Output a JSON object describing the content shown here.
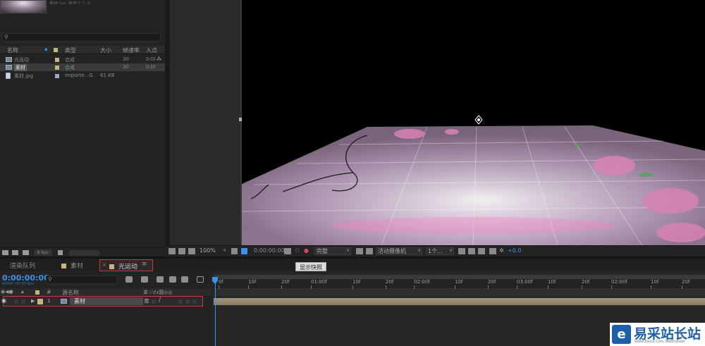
{
  "colors": {
    "timecode": "#3b93e8",
    "label_sandstone": "#c8b47e",
    "highlight_box": "#c53a3a",
    "watermark_blue": "#1d5fa8"
  },
  "project": {
    "thumb_info": "素材.jpg, 使用了 1 次",
    "search_placeholder": "",
    "columns": {
      "name": "名称",
      "type": "类型",
      "size": "大小",
      "fps": "帧速率",
      "in": "入点"
    },
    "items": [
      {
        "name": "光运动",
        "type": "合成",
        "size": "",
        "fps": "30",
        "in": "0:0(",
        "icon": "composition-icon"
      },
      {
        "name": "素材",
        "type": "合成",
        "size": "",
        "fps": "30",
        "in": "0:0(",
        "icon": "composition-icon"
      },
      {
        "name": "素材.jpg",
        "type": "Importe...G",
        "size": "61 KB",
        "fps": "",
        "in": "",
        "icon": "image-file-icon"
      }
    ],
    "bpc": "8 bpc"
  },
  "viewer_toolbar": {
    "zoom": "100%",
    "timecode": "0:00:00:00",
    "resolution": "完整",
    "camera": "活动摄像机",
    "views": "1个...",
    "exposure": "+0.0"
  },
  "timeline": {
    "tabs": {
      "render_queue": "渲染队列",
      "comp_material": "素材",
      "comp_active": "光运动",
      "close": "×",
      "menu": "≡"
    },
    "tooltip": "显示快照",
    "timecode": "0:00:00:00",
    "timecode_sub": "00000 (30.00 fps)",
    "search_placeholder": "",
    "layer_header": {
      "hash": "#",
      "source_name": "源名称",
      "switches": "单☆\\fx圓◎◎"
    },
    "layer": {
      "index": "1",
      "name": "素材"
    },
    "ruler": [
      "0f",
      "10f",
      "20f",
      "01:00f",
      "10f",
      "20f",
      "02:00f",
      "10f",
      "20f",
      "03:00f",
      "10f",
      "20f",
      "02:00f",
      "10f",
      "20f"
    ]
  },
  "watermark": {
    "logo": "e",
    "title": "易采站长站",
    "url": "Www.Easck.Com Webmaster"
  }
}
